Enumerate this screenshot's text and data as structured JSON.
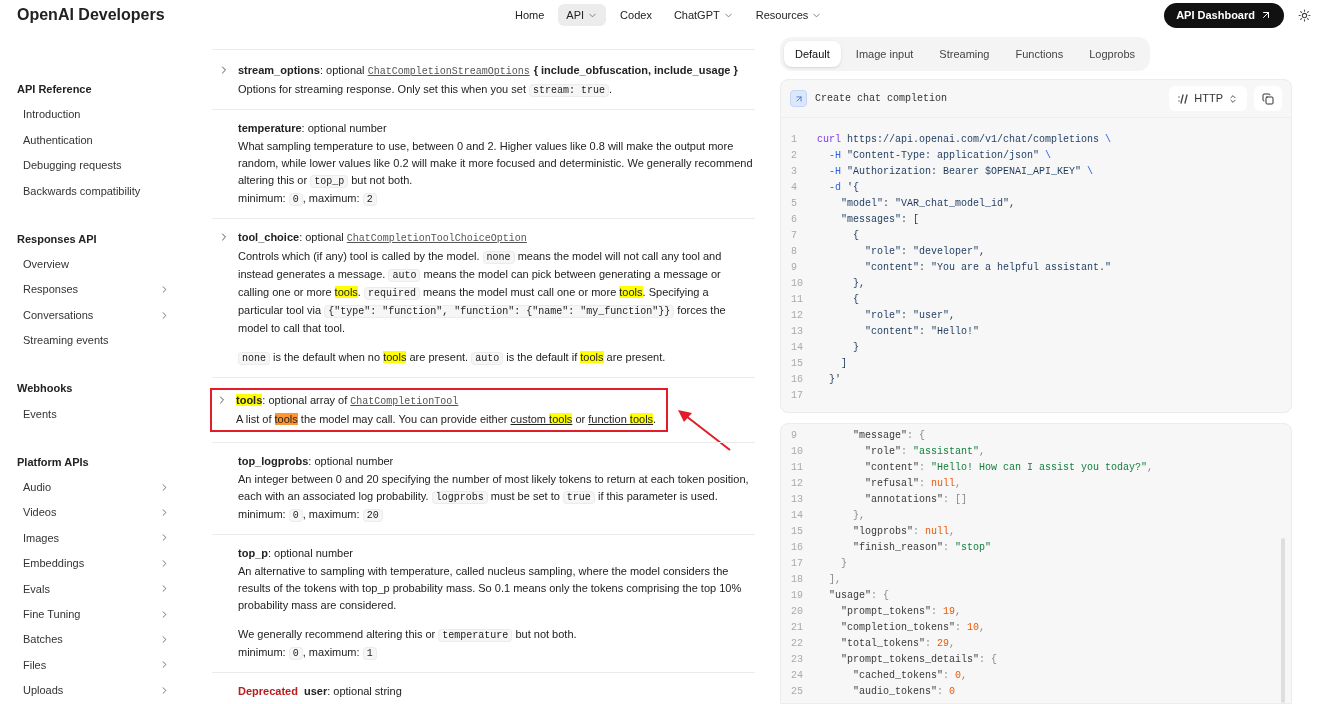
{
  "header": {
    "logo": "OpenAI Developers",
    "nav": [
      {
        "label": "Home",
        "dropdown": false,
        "selected": false
      },
      {
        "label": "API",
        "dropdown": true,
        "selected": true
      },
      {
        "label": "Codex",
        "dropdown": false,
        "selected": false
      },
      {
        "label": "ChatGPT",
        "dropdown": true,
        "selected": false
      },
      {
        "label": "Resources",
        "dropdown": true,
        "selected": false
      }
    ],
    "dashboard_button": "API Dashboard"
  },
  "sidebar": [
    {
      "title": "API Reference",
      "items": [
        {
          "label": "Introduction",
          "expandable": false
        },
        {
          "label": "Authentication",
          "expandable": false
        },
        {
          "label": "Debugging requests",
          "expandable": false
        },
        {
          "label": "Backwards compatibility",
          "expandable": false
        }
      ]
    },
    {
      "title": "Responses API",
      "items": [
        {
          "label": "Overview",
          "expandable": false
        },
        {
          "label": "Responses",
          "expandable": true
        },
        {
          "label": "Conversations",
          "expandable": true
        },
        {
          "label": "Streaming events",
          "expandable": false
        }
      ]
    },
    {
      "title": "Webhooks",
      "items": [
        {
          "label": "Events",
          "expandable": false
        }
      ]
    },
    {
      "title": "Platform APIs",
      "items": [
        {
          "label": "Audio",
          "expandable": true
        },
        {
          "label": "Videos",
          "expandable": true
        },
        {
          "label": "Images",
          "expandable": true
        },
        {
          "label": "Embeddings",
          "expandable": true
        },
        {
          "label": "Evals",
          "expandable": true
        },
        {
          "label": "Fine Tuning",
          "expandable": true
        },
        {
          "label": "Batches",
          "expandable": true
        },
        {
          "label": "Files",
          "expandable": true
        },
        {
          "label": "Uploads",
          "expandable": true
        }
      ]
    }
  ],
  "parameters": [
    {
      "expandable": true,
      "framed": false,
      "heading": [
        {
          "kind": "name",
          "text": "stream_options"
        },
        {
          "kind": "text",
          "text": ": optional "
        },
        {
          "kind": "typelink",
          "text": "ChatCompletionStreamOptions"
        },
        {
          "kind": "bold",
          "text": "{ include_obfuscation, include_usage }"
        }
      ],
      "paragraphs": [
        {
          "spaced": false,
          "segments": [
            {
              "kind": "text",
              "text": "Options for streaming response. Only set this when you set "
            },
            {
              "kind": "code",
              "text": "stream: true"
            },
            {
              "kind": "text",
              "text": "."
            }
          ]
        }
      ]
    },
    {
      "expandable": false,
      "framed": false,
      "heading": [
        {
          "kind": "name",
          "text": "temperature"
        },
        {
          "kind": "text",
          "text": ": optional number"
        }
      ],
      "paragraphs": [
        {
          "spaced": false,
          "segments": [
            {
              "kind": "text",
              "text": "What sampling temperature to use, between 0 and 2. Higher values like 0.8 will make the output more random, while lower values like 0.2 will make it more focused and deterministic. We generally recommend altering this or "
            },
            {
              "kind": "code",
              "text": "top_p"
            },
            {
              "kind": "text",
              "text": " but not both."
            }
          ]
        },
        {
          "spaced": false,
          "segments": [
            {
              "kind": "text",
              "text": "minimum: "
            },
            {
              "kind": "code",
              "text": "0"
            },
            {
              "kind": "text",
              "text": ", maximum: "
            },
            {
              "kind": "code",
              "text": "2"
            }
          ]
        }
      ]
    },
    {
      "expandable": true,
      "framed": false,
      "heading": [
        {
          "kind": "name",
          "text": "tool_choice"
        },
        {
          "kind": "text",
          "text": ": optional "
        },
        {
          "kind": "typelink",
          "text": "ChatCompletionToolChoiceOption"
        }
      ],
      "paragraphs": [
        {
          "spaced": false,
          "segments": [
            {
              "kind": "text",
              "text": "Controls which (if any) tool is called by the model. "
            },
            {
              "kind": "code",
              "text": "none"
            },
            {
              "kind": "text",
              "text": " means the model will not call any tool and instead generates a message. "
            },
            {
              "kind": "code",
              "text": "auto"
            },
            {
              "kind": "text",
              "text": " means the model can pick between generating a message or calling one or more "
            },
            {
              "kind": "hl",
              "text": "tools"
            },
            {
              "kind": "text",
              "text": ". "
            },
            {
              "kind": "code",
              "text": "required"
            },
            {
              "kind": "text",
              "text": " means the model must call one or more "
            },
            {
              "kind": "hl",
              "text": "tools"
            },
            {
              "kind": "text",
              "text": ". Specifying a particular tool via "
            },
            {
              "kind": "code",
              "text": "{\"type\": \"function\", \"function\": {\"name\": \"my_function\"}}"
            },
            {
              "kind": "text",
              "text": " forces the model to call that tool."
            }
          ]
        },
        {
          "spaced": true,
          "segments": [
            {
              "kind": "code",
              "text": "none"
            },
            {
              "kind": "text",
              "text": " is the default when no "
            },
            {
              "kind": "hl",
              "text": "tools"
            },
            {
              "kind": "text",
              "text": " are present. "
            },
            {
              "kind": "code",
              "text": "auto"
            },
            {
              "kind": "text",
              "text": " is the default if "
            },
            {
              "kind": "hl",
              "text": "tools"
            },
            {
              "kind": "text",
              "text": " are present."
            }
          ]
        }
      ]
    },
    {
      "expandable": true,
      "framed": true,
      "heading": [
        {
          "kind": "name_hl",
          "text": "tools"
        },
        {
          "kind": "text",
          "text": ": optional array of "
        },
        {
          "kind": "typelink",
          "text": "ChatCompletionTool"
        }
      ],
      "paragraphs": [
        {
          "spaced": false,
          "segments": [
            {
              "kind": "text",
              "text": "A list of "
            },
            {
              "kind": "hl_current",
              "text": "tools"
            },
            {
              "kind": "text",
              "text": " the model may call. You can provide either "
            },
            {
              "kind": "link",
              "parts": [
                {
                  "kind": "text",
                  "text": "custom "
                },
                {
                  "kind": "hl",
                  "text": "tools"
                }
              ]
            },
            {
              "kind": "text",
              "text": " or "
            },
            {
              "kind": "link",
              "parts": [
                {
                  "kind": "text",
                  "text": "function "
                },
                {
                  "kind": "hl",
                  "text": "tools"
                }
              ]
            },
            {
              "kind": "text",
              "text": "."
            }
          ]
        }
      ]
    },
    {
      "expandable": false,
      "framed": false,
      "heading": [
        {
          "kind": "name",
          "text": "top_logprobs"
        },
        {
          "kind": "text",
          "text": ": optional number"
        }
      ],
      "paragraphs": [
        {
          "spaced": false,
          "segments": [
            {
              "kind": "text",
              "text": "An integer between 0 and 20 specifying the number of most likely tokens to return at each token position, each with an associated log probability. "
            },
            {
              "kind": "code",
              "text": "logprobs"
            },
            {
              "kind": "text",
              "text": " must be set to "
            },
            {
              "kind": "code",
              "text": "true"
            },
            {
              "kind": "text",
              "text": " if this parameter is used."
            }
          ]
        },
        {
          "spaced": false,
          "segments": [
            {
              "kind": "text",
              "text": "minimum: "
            },
            {
              "kind": "code",
              "text": "0"
            },
            {
              "kind": "text",
              "text": ", maximum: "
            },
            {
              "kind": "code",
              "text": "20"
            }
          ]
        }
      ]
    },
    {
      "expandable": false,
      "framed": false,
      "heading": [
        {
          "kind": "name",
          "text": "top_p"
        },
        {
          "kind": "text",
          "text": ": optional number"
        }
      ],
      "paragraphs": [
        {
          "spaced": false,
          "segments": [
            {
              "kind": "text",
              "text": "An alternative to sampling with temperature, called nucleus sampling, where the model considers the results of the tokens with top_p probability mass. So 0.1 means only the tokens comprising the top 10% probability mass are considered."
            }
          ]
        },
        {
          "spaced": true,
          "segments": [
            {
              "kind": "text",
              "text": "We generally recommend altering this or "
            },
            {
              "kind": "code",
              "text": "temperature"
            },
            {
              "kind": "text",
              "text": " but not both."
            }
          ]
        },
        {
          "spaced": false,
          "segments": [
            {
              "kind": "text",
              "text": "minimum: "
            },
            {
              "kind": "code",
              "text": "0"
            },
            {
              "kind": "text",
              "text": ", maximum: "
            },
            {
              "kind": "code",
              "text": "1"
            }
          ]
        }
      ]
    },
    {
      "expandable": false,
      "framed": false,
      "heading": [
        {
          "kind": "deprecated",
          "text": "Deprecated"
        },
        {
          "kind": "name",
          "text": "user"
        },
        {
          "kind": "text",
          "text": ": optional string"
        }
      ]
    }
  ],
  "example_tabs": [
    {
      "label": "Default",
      "selected": true
    },
    {
      "label": "Image input",
      "selected": false
    },
    {
      "label": "Streaming",
      "selected": false
    },
    {
      "label": "Functions",
      "selected": false
    },
    {
      "label": "Logprobs",
      "selected": false
    }
  ],
  "request": {
    "title": "Create chat completion",
    "language": "HTTP",
    "lines": [
      {
        "n": "1",
        "tokens": [
          {
            "kind": "kw",
            "text": "curl"
          },
          {
            "kind": "str",
            "text": " https://api.openai.com/v1/chat/completions "
          },
          {
            "kind": "flag",
            "text": "\\"
          }
        ]
      },
      {
        "n": "2",
        "tokens": [
          {
            "kind": "flag",
            "text": "  -H"
          },
          {
            "kind": "str",
            "text": " \"Content-Type: application/json\" "
          },
          {
            "kind": "flag",
            "text": "\\"
          }
        ]
      },
      {
        "n": "3",
        "tokens": [
          {
            "kind": "flag",
            "text": "  -H"
          },
          {
            "kind": "str",
            "text": " \"Authorization: Bearer $OPENAI_API_KEY\" "
          },
          {
            "kind": "flag",
            "text": "\\"
          }
        ]
      },
      {
        "n": "4",
        "tokens": [
          {
            "kind": "flag",
            "text": "  -d"
          },
          {
            "kind": "str",
            "text": " '{"
          }
        ]
      },
      {
        "n": "5",
        "tokens": [
          {
            "kind": "str",
            "text": "    \"model\": \"VAR_chat_model_id\","
          }
        ]
      },
      {
        "n": "6",
        "tokens": [
          {
            "kind": "str",
            "text": "    \"messages\": ["
          }
        ]
      },
      {
        "n": "7",
        "tokens": [
          {
            "kind": "str",
            "text": "      {"
          }
        ]
      },
      {
        "n": "8",
        "tokens": [
          {
            "kind": "str",
            "text": "        \"role\": \"developer\","
          }
        ]
      },
      {
        "n": "9",
        "tokens": [
          {
            "kind": "str",
            "text": "        \"content\": \"You are a helpful assistant.\""
          }
        ]
      },
      {
        "n": "10",
        "tokens": [
          {
            "kind": "str",
            "text": "      },"
          }
        ]
      },
      {
        "n": "11",
        "tokens": [
          {
            "kind": "str",
            "text": "      {"
          }
        ]
      },
      {
        "n": "12",
        "tokens": [
          {
            "kind": "str",
            "text": "        \"role\": \"user\","
          }
        ]
      },
      {
        "n": "13",
        "tokens": [
          {
            "kind": "str",
            "text": "        \"content\": \"Hello!\""
          }
        ]
      },
      {
        "n": "14",
        "tokens": [
          {
            "kind": "str",
            "text": "      }"
          }
        ]
      },
      {
        "n": "15",
        "tokens": [
          {
            "kind": "str",
            "text": "    ]"
          }
        ]
      },
      {
        "n": "16",
        "tokens": [
          {
            "kind": "str",
            "text": "  }'"
          }
        ]
      },
      {
        "n": "17"
      }
    ]
  },
  "response": {
    "lines": [
      {
        "n": "9",
        "tokens": [
          {
            "kind": "key",
            "text": "      \"message\""
          },
          {
            "kind": "punct",
            "text": ": {"
          }
        ]
      },
      {
        "n": "10",
        "tokens": [
          {
            "kind": "key",
            "text": "        \"role\""
          },
          {
            "kind": "punct",
            "text": ": "
          },
          {
            "kind": "green",
            "text": "\"assistant\""
          },
          {
            "kind": "punct",
            "text": ","
          }
        ]
      },
      {
        "n": "11",
        "tokens": [
          {
            "kind": "key",
            "text": "        \"content\""
          },
          {
            "kind": "punct",
            "text": ": "
          },
          {
            "kind": "green",
            "text": "\"Hello! How can I assist you today?\""
          },
          {
            "kind": "punct",
            "text": ","
          }
        ]
      },
      {
        "n": "12",
        "tokens": [
          {
            "kind": "key",
            "text": "        \"refusal\""
          },
          {
            "kind": "punct",
            "text": ": "
          },
          {
            "kind": "num",
            "text": "null"
          },
          {
            "kind": "punct",
            "text": ","
          }
        ]
      },
      {
        "n": "13",
        "tokens": [
          {
            "kind": "key",
            "text": "        \"annotations\""
          },
          {
            "kind": "punct",
            "text": ": []"
          }
        ]
      },
      {
        "n": "14",
        "tokens": [
          {
            "kind": "punct",
            "text": "      },"
          }
        ]
      },
      {
        "n": "15",
        "tokens": [
          {
            "kind": "key",
            "text": "      \"logprobs\""
          },
          {
            "kind": "punct",
            "text": ": "
          },
          {
            "kind": "num",
            "text": "null"
          },
          {
            "kind": "punct",
            "text": ","
          }
        ]
      },
      {
        "n": "16",
        "tokens": [
          {
            "kind": "key",
            "text": "      \"finish_reason\""
          },
          {
            "kind": "punct",
            "text": ": "
          },
          {
            "kind": "green",
            "text": "\"stop\""
          }
        ]
      },
      {
        "n": "17",
        "tokens": [
          {
            "kind": "punct",
            "text": "    }"
          }
        ]
      },
      {
        "n": "18",
        "tokens": [
          {
            "kind": "punct",
            "text": "  ],"
          }
        ]
      },
      {
        "n": "19",
        "tokens": [
          {
            "kind": "key",
            "text": "  \"usage\""
          },
          {
            "kind": "punct",
            "text": ": {"
          }
        ]
      },
      {
        "n": "20",
        "tokens": [
          {
            "kind": "key",
            "text": "    \"prompt_tokens\""
          },
          {
            "kind": "punct",
            "text": ": "
          },
          {
            "kind": "num",
            "text": "19"
          },
          {
            "kind": "punct",
            "text": ","
          }
        ]
      },
      {
        "n": "21",
        "tokens": [
          {
            "kind": "key",
            "text": "    \"completion_tokens\""
          },
          {
            "kind": "punct",
            "text": ": "
          },
          {
            "kind": "num",
            "text": "10"
          },
          {
            "kind": "punct",
            "text": ","
          }
        ]
      },
      {
        "n": "22",
        "tokens": [
          {
            "kind": "key",
            "text": "    \"total_tokens\""
          },
          {
            "kind": "punct",
            "text": ": "
          },
          {
            "kind": "num",
            "text": "29"
          },
          {
            "kind": "punct",
            "text": ","
          }
        ]
      },
      {
        "n": "23",
        "tokens": [
          {
            "kind": "key",
            "text": "    \"prompt_tokens_details\""
          },
          {
            "kind": "punct",
            "text": ": {"
          }
        ]
      },
      {
        "n": "24",
        "tokens": [
          {
            "kind": "key",
            "text": "      \"cached_tokens\""
          },
          {
            "kind": "punct",
            "text": ": "
          },
          {
            "kind": "num",
            "text": "0"
          },
          {
            "kind": "punct",
            "text": ","
          }
        ]
      },
      {
        "n": "25",
        "tokens": [
          {
            "kind": "key",
            "text": "      \"audio_tokens\""
          },
          {
            "kind": "punct",
            "text": ": "
          },
          {
            "kind": "num",
            "text": "0"
          }
        ]
      }
    ]
  }
}
